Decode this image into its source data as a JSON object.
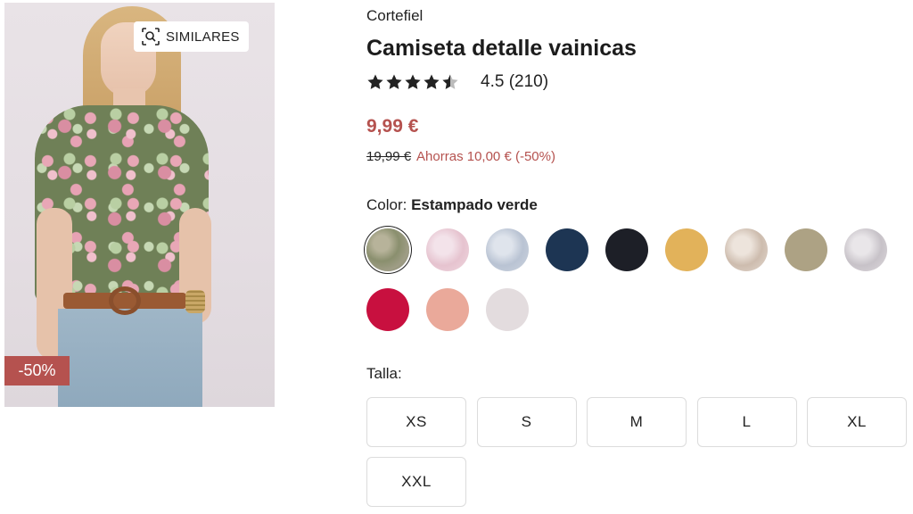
{
  "product": {
    "brand": "Cortefiel",
    "title": "Camiseta detalle vainicas",
    "rating_value": 4.5,
    "rating_text": "4.5 (210)",
    "price": "9,99 €",
    "old_price": "19,99 €",
    "savings": "Ahorras 10,00 € (-50%)"
  },
  "image": {
    "similar_label": "SIMILARES",
    "discount_badge": "-50%",
    "search_icon": "image-search-icon"
  },
  "colors": {
    "label": "Color:",
    "selected_value": "Estampado verde",
    "swatches": [
      {
        "name": "estampado-verde",
        "fill": "radial-gradient(circle at 35% 35%, #b7b39a 0 20%, #8a8f6e 45%, #9f9d86 70%, #7b7f62 100%)",
        "selected": true
      },
      {
        "name": "estampado-rosa",
        "fill": "radial-gradient(circle at 40% 40%, #f3e3ea 0 25%, #e6c3cf 55%, #efd7df 100%)",
        "selected": false
      },
      {
        "name": "estampado-azul",
        "fill": "radial-gradient(circle at 40% 40%, #dfe4ec 0 25%, #b9c3d3 55%, #cdd4df 100%)",
        "selected": false
      },
      {
        "name": "marino",
        "fill": "#1d3553",
        "selected": false
      },
      {
        "name": "negro",
        "fill": "#1d1f27",
        "selected": false
      },
      {
        "name": "mostaza",
        "fill": "#e2b25a",
        "selected": false
      },
      {
        "name": "estampado-beige",
        "fill": "radial-gradient(circle at 40% 40%, #ede4dc 0 25%, #cdbcae 55%, #e3d8cf 100%)",
        "selected": false
      },
      {
        "name": "taupe",
        "fill": "#ada284",
        "selected": false
      },
      {
        "name": "estampado-gris",
        "fill": "radial-gradient(circle at 40% 40%, #e9e6e9 0 25%, #c7c2c8 55%, #ddd8dc 100%)",
        "selected": false
      },
      {
        "name": "fucsia",
        "fill": "#c8103f",
        "selected": false
      },
      {
        "name": "coral",
        "fill": "#eaa99a",
        "selected": false
      },
      {
        "name": "gris-claro",
        "fill": "#e3dcde",
        "selected": false
      }
    ]
  },
  "sizes": {
    "label": "Talla:",
    "options": [
      "XS",
      "S",
      "M",
      "L",
      "XL",
      "XXL"
    ]
  },
  "colors_theme": {
    "accent": "#b5524f",
    "text": "#222222"
  }
}
